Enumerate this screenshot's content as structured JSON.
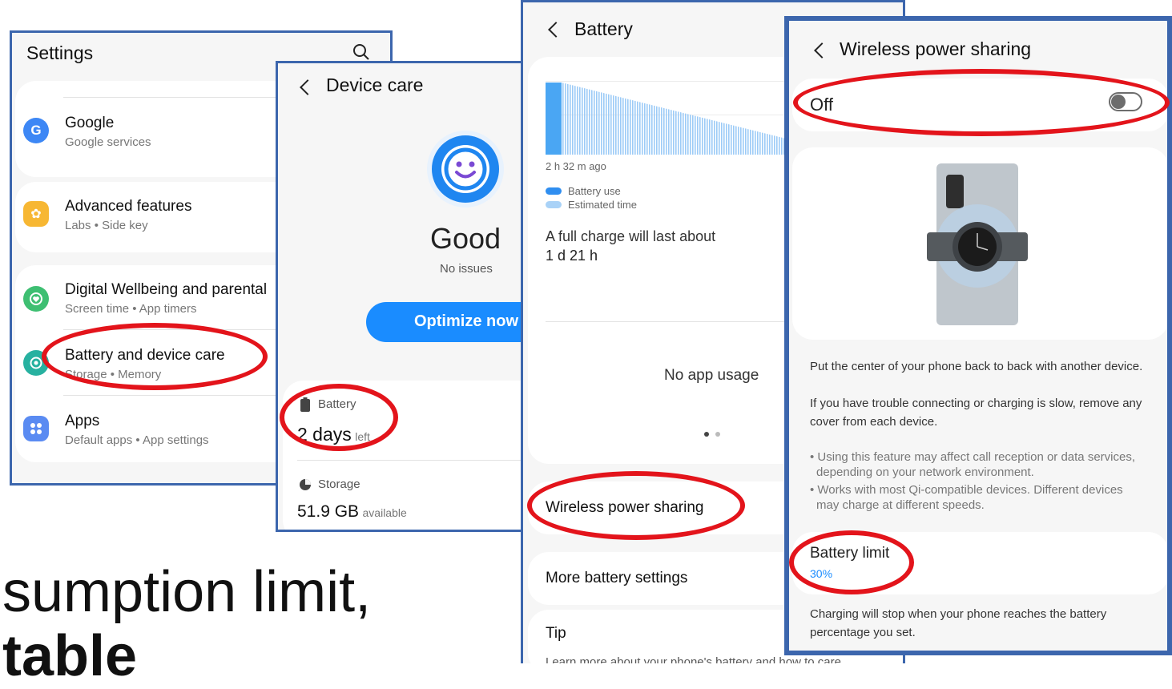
{
  "colors": {
    "border": "#3c66ad",
    "accent": "#1a8cff",
    "annotation": "#e3141b"
  },
  "overlay_text": {
    "line1": "sumption limit,",
    "line2": "table"
  },
  "settings": {
    "title": "Settings",
    "search_icon": "search-icon",
    "items": [
      {
        "title": "Google",
        "subtitle": "Google services",
        "icon": "google-icon",
        "color": "#3d87f5"
      },
      {
        "title": "Advanced features",
        "subtitle": "Labs  •  Side key",
        "icon": "advanced-features-icon",
        "color": "#f7b733"
      },
      {
        "title": "Digital Wellbeing and parental",
        "subtitle": "Screen time  •  App timers",
        "icon": "wellbeing-icon",
        "color": "#3ebf72"
      },
      {
        "title": "Battery and device care",
        "subtitle": "Storage  •  Memory",
        "icon": "device-care-icon",
        "color": "#27b1a0"
      },
      {
        "title": "Apps",
        "subtitle": "Default apps  •  App settings",
        "icon": "apps-icon",
        "color": "#5a8bf2"
      }
    ]
  },
  "device_care": {
    "title": "Device care",
    "status": "Good",
    "status_sub": "No issues",
    "optimize_label": "Optimize now",
    "battery_label": "Battery",
    "battery_value": "2 days",
    "battery_unit": "left",
    "storage_label": "Storage",
    "storage_value": "51.9 GB",
    "storage_unit": "available"
  },
  "battery": {
    "title": "Battery",
    "time_ago": "2 h 32 m ago",
    "legend_use": "Battery use",
    "legend_est": "Estimated time",
    "full_charge": "A full charge will last about",
    "full_charge_value": "1 d 21 h",
    "no_usage": "No app usage",
    "wireless_sharing": "Wireless power sharing",
    "more_settings": "More battery settings",
    "tip": "Tip",
    "tip_text": "Learn more about your phone's battery and how to care"
  },
  "wireless": {
    "title": "Wireless power sharing",
    "toggle_label": "Off",
    "desc1": "Put the center of your phone back to back with another device.",
    "desc2": "If you have trouble connecting or charging is slow, remove any cover from each device.",
    "note1": "• Using this feature may affect call reception or data services, depending on your network environment.",
    "note2": "• Works with most Qi-compatible devices. Different devices may charge at different speeds.",
    "limit_label": "Battery limit",
    "limit_value": "30%",
    "limit_desc": "Charging will stop when your phone reaches the battery percentage you set."
  }
}
